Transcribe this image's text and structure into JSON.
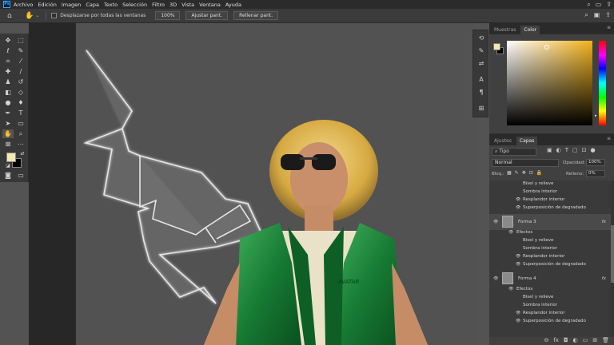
{
  "menubar": {
    "app_icon": "Ps",
    "items": [
      "Archivo",
      "Edición",
      "Imagen",
      "Capa",
      "Texto",
      "Selección",
      "Filtro",
      "3D",
      "Vista",
      "Ventana",
      "Ayuda"
    ],
    "right_icons": [
      "search-icon",
      "workspace-icon",
      "share-icon"
    ]
  },
  "options": {
    "scroll_all_label": "Desplazarse por todas las ventanas",
    "zoom_button": "100%",
    "fit_button": "Ajustar pant.",
    "fill_button": "Rellenar pant."
  },
  "colors": {
    "foreground": "#f6e8b1",
    "background": "#000000",
    "accent": "#31a8ff"
  },
  "color_panel": {
    "tabs": [
      "Muestras",
      "Color"
    ],
    "active_tab": "Color"
  },
  "layers_panel": {
    "tabs": [
      "Ajustes",
      "Capas"
    ],
    "active_tab": "Capas",
    "filter_label": "Tipo",
    "blend_mode": "Normal",
    "opacity_label": "Opacidad:",
    "opacity_value": "100%",
    "lock_label": "Bloq.:",
    "fill_label": "Relleno:",
    "fill_value": "0%",
    "layers": [
      {
        "kind": "effect",
        "label": "Bisel y relieve"
      },
      {
        "kind": "effect",
        "label": "Sombra interior"
      },
      {
        "kind": "effect",
        "label": "Resplandor interior"
      },
      {
        "kind": "effect",
        "label": "Superposición de degradado"
      },
      {
        "kind": "layer",
        "label": "Forma 3",
        "fx": "fx"
      },
      {
        "kind": "effects-header",
        "label": "Efectos"
      },
      {
        "kind": "effect",
        "label": "Bisel y relieve"
      },
      {
        "kind": "effect",
        "label": "Sombra interior"
      },
      {
        "kind": "effect",
        "label": "Resplandor interior"
      },
      {
        "kind": "effect",
        "label": "Superposición de degradado"
      },
      {
        "kind": "layer",
        "label": "Forma 4",
        "fx": "fx"
      },
      {
        "kind": "effects-header",
        "label": "Efectos"
      },
      {
        "kind": "effect",
        "label": "Bisel y relieve"
      },
      {
        "kind": "effect",
        "label": "Sombra interior"
      },
      {
        "kind": "effect",
        "label": "Resplandor interior"
      },
      {
        "kind": "effect",
        "label": "Superposición de degradado"
      }
    ]
  },
  "canvas": {
    "vest_text": "AVATAR"
  }
}
